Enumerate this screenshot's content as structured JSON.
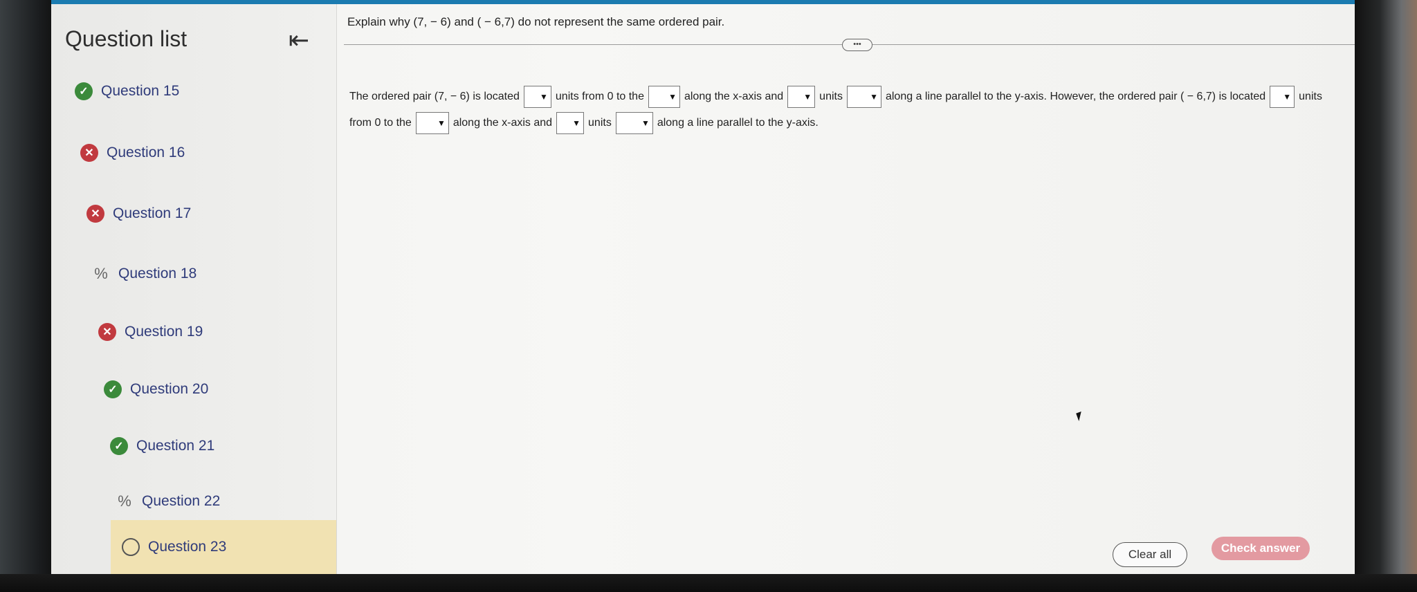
{
  "sidebar": {
    "title": "Question list",
    "collapse_icon": "collapse-left-icon",
    "items": [
      {
        "label": "Question 15",
        "status": "correct"
      },
      {
        "label": "Question 16",
        "status": "incorrect"
      },
      {
        "label": "Question 17",
        "status": "incorrect"
      },
      {
        "label": "Question 18",
        "status": "partial"
      },
      {
        "label": "Question 19",
        "status": "incorrect"
      },
      {
        "label": "Question 20",
        "status": "correct"
      },
      {
        "label": "Question 21",
        "status": "correct"
      },
      {
        "label": "Question 22",
        "status": "partial"
      },
      {
        "label": "Question 23",
        "status": "unanswered"
      }
    ]
  },
  "question": {
    "prompt": "Explain why (7, − 6) and ( − 6,7) do not represent the same ordered pair.",
    "more_label": "•••",
    "answer": {
      "t1": "The ordered pair (7, − 6) is located",
      "t2": "units from 0 to the",
      "t3": "along the x-axis and",
      "t4": "units",
      "t5": "along a line parallel to the y-axis. However, the ordered pair ( − 6,7) is located",
      "t6": "units",
      "t7": "from 0 to the",
      "t8": "along the x-axis and",
      "t9": "units",
      "t10": "along a line parallel to the y-axis."
    }
  },
  "actions": {
    "clear_label": "Clear all",
    "check_label": "Check answer"
  },
  "colors": {
    "correct": "#3b8a3b",
    "incorrect": "#c13a3f",
    "active_row": "#f1e2b2",
    "check_button": "#e39aa1",
    "link_text": "#2f3b7a"
  }
}
